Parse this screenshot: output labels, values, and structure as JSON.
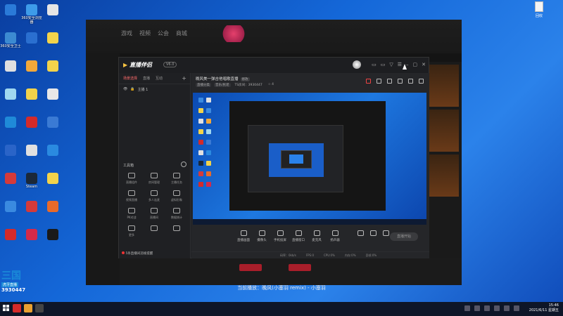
{
  "desktop": {
    "icons": [
      {
        "label": "",
        "color": "#2a7ad8"
      },
      {
        "label": "360安全浏览器",
        "color": "#3d9be9"
      },
      {
        "label": "",
        "color": "#e5e5e5"
      },
      {
        "label": "360安全卫士",
        "color": "#3c8ad1"
      },
      {
        "label": "",
        "color": "#2a6fd0"
      },
      {
        "label": "",
        "color": "#f2d34b"
      },
      {
        "label": "",
        "color": "#e0e0e0"
      },
      {
        "label": "",
        "color": "#f2a83a"
      },
      {
        "label": "",
        "color": "#f2d34b"
      },
      {
        "label": "",
        "color": "#a0d8f0"
      },
      {
        "label": "",
        "color": "#f2d34b"
      },
      {
        "label": "",
        "color": "#e8e8e8"
      },
      {
        "label": "",
        "color": "#1f8ad8"
      },
      {
        "label": "",
        "color": "#d42a2a"
      },
      {
        "label": "",
        "color": "#3a7ad4"
      },
      {
        "label": "",
        "color": "#2a64c8"
      },
      {
        "label": "",
        "color": "#e0e0e0"
      },
      {
        "label": "",
        "color": "#2a8ae0"
      },
      {
        "label": "",
        "color": "#d43a3a"
      },
      {
        "label": "Steam",
        "color": "#1b2838"
      },
      {
        "label": "",
        "color": "#f2d34b"
      },
      {
        "label": "",
        "color": "#3a8ae0"
      },
      {
        "label": "",
        "color": "#d43a3a"
      },
      {
        "label": "",
        "color": "#e86a2a"
      },
      {
        "label": "",
        "color": "#d42a2a"
      },
      {
        "label": "",
        "color": "#d42a4a"
      },
      {
        "label": "",
        "color": "#1a1a1a"
      }
    ],
    "right_icon_label": "回收"
  },
  "game_client": {
    "tabs": [
      "游戏",
      "视频",
      "公会",
      "商城"
    ],
    "sub_tabs": [
      "",
      "",
      "",
      "",
      "",
      ""
    ],
    "bottom_buttons": [
      "",
      ""
    ]
  },
  "caption": "当前播放：晚风(小塞羽 remix) - 小塞羽",
  "app": {
    "logo": "直播伴侣",
    "version": "V6.0",
    "window_controls": [
      "▭",
      "▭",
      "▽",
      "☰",
      "–",
      "▢",
      "✕"
    ],
    "left_tabs": [
      {
        "label": "场景选择",
        "active": true
      },
      {
        "label": "直播",
        "active": false
      },
      {
        "label": "互动",
        "active": false
      }
    ],
    "scene": {
      "visible_icon": "👁",
      "lock_icon": "🔒",
      "label": "主播 1"
    },
    "tools_heading": "工具箱",
    "tools": [
      {
        "label": "直播组件"
      },
      {
        "label": "房间管理"
      },
      {
        "label": "主播任务"
      },
      {
        "label": "视频直播"
      },
      {
        "label": "多人连麦"
      },
      {
        "label": "虚拟形象"
      },
      {
        "label": "PK对战"
      },
      {
        "label": "直播间"
      },
      {
        "label": "数据统计"
      },
      {
        "label": "更多"
      },
      {
        "label": ""
      },
      {
        "label": ""
      }
    ],
    "notice": "5条直播间违规提醒",
    "room": {
      "title": "晚风美一弹吉他唱歌直播",
      "tag": "修改",
      "meta": [
        "直播分类",
        "音乐/民谣",
        "TS房间：3930447",
        "☆ 4"
      ]
    },
    "bottom_tools": [
      {
        "label": "直播画面"
      },
      {
        "label": "摄像头"
      },
      {
        "label": "手机投屏"
      },
      {
        "label": "直播窗口"
      },
      {
        "label": "麦克风"
      },
      {
        "label": "扬声器"
      },
      {
        "label": ""
      },
      {
        "label": ""
      },
      {
        "label": ""
      }
    ],
    "live_button": "直播开始",
    "status": [
      "码率：0kb/s",
      "FPS:0",
      "CPU:0%",
      "内存:0%",
      "丢帧:0%"
    ]
  },
  "watermark": {
    "logo": "三国",
    "sub": "虎牙直播",
    "number": "3930447"
  },
  "taskbar": {
    "time": "15:46",
    "date": "2021/6/11 星期五"
  }
}
